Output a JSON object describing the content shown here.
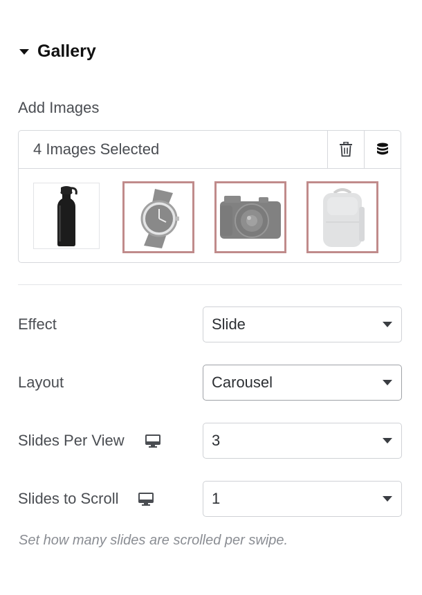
{
  "section": {
    "title": "Gallery",
    "icon": "caret-down-icon"
  },
  "add_images": {
    "label": "Add Images",
    "count_text": "4 Images Selected",
    "delete_icon": "trash-icon",
    "library_icon": "database-icon",
    "images": [
      {
        "name": "water-bottle",
        "selected": false
      },
      {
        "name": "wristwatch",
        "selected": true
      },
      {
        "name": "camera",
        "selected": true
      },
      {
        "name": "backpack",
        "selected": true
      }
    ]
  },
  "controls": {
    "effect": {
      "label": "Effect",
      "value": "Slide"
    },
    "layout": {
      "label": "Layout",
      "value": "Carousel"
    },
    "slides_per_view": {
      "label": "Slides Per View",
      "value": "3",
      "device_icon": "desktop-icon"
    },
    "slides_to_scroll": {
      "label": "Slides to Scroll",
      "value": "1",
      "device_icon": "desktop-icon"
    }
  },
  "help_text": "Set how many slides are scrolled per swipe.",
  "colors": {
    "selected_border": "#c08b8b",
    "text": "#4a4d52",
    "muted": "#8a8d93"
  }
}
